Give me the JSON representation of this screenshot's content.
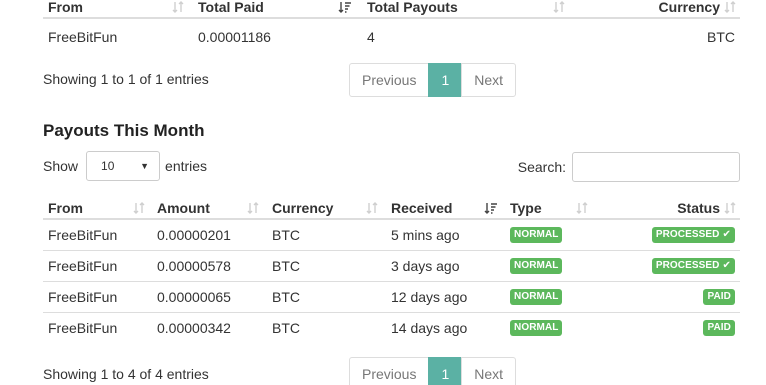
{
  "top_table": {
    "headers": [
      "From",
      "Total Paid",
      "Total Payouts",
      "Currency"
    ],
    "rows": [
      {
        "from": "FreeBitFun",
        "total_paid": "0.00001186",
        "total_payouts": "4",
        "currency": "BTC"
      }
    ],
    "info": "Showing 1 to 1 of 1 entries",
    "pagination": {
      "prev": "Previous",
      "current": "1",
      "next": "Next"
    }
  },
  "month_section": {
    "title": "Payouts This Month",
    "length": {
      "show_label": "Show",
      "value": "10",
      "entries_label": "entries"
    },
    "search_label": "Search:",
    "headers": [
      "From",
      "Amount",
      "Currency",
      "Received",
      "Type",
      "Status"
    ],
    "rows": [
      {
        "from": "FreeBitFun",
        "amount": "0.00000201",
        "currency": "BTC",
        "received": "5 mins ago",
        "type": "NORMAL",
        "status": "PROCESSED",
        "status_icon": "check-icon"
      },
      {
        "from": "FreeBitFun",
        "amount": "0.00000578",
        "currency": "BTC",
        "received": "3 days ago",
        "type": "NORMAL",
        "status": "PROCESSED",
        "status_icon": "check-icon"
      },
      {
        "from": "FreeBitFun",
        "amount": "0.00000065",
        "currency": "BTC",
        "received": "12 days ago",
        "type": "NORMAL",
        "status": "PAID"
      },
      {
        "from": "FreeBitFun",
        "amount": "0.00000342",
        "currency": "BTC",
        "received": "14 days ago",
        "type": "NORMAL",
        "status": "PAID"
      }
    ],
    "info": "Showing 1 to 4 of 4 entries",
    "pagination": {
      "prev": "Previous",
      "current": "1",
      "next": "Next"
    }
  },
  "colors": {
    "accent": "#5bb1a4",
    "badge_green": "#5cb85c",
    "border": "#dddddd"
  }
}
